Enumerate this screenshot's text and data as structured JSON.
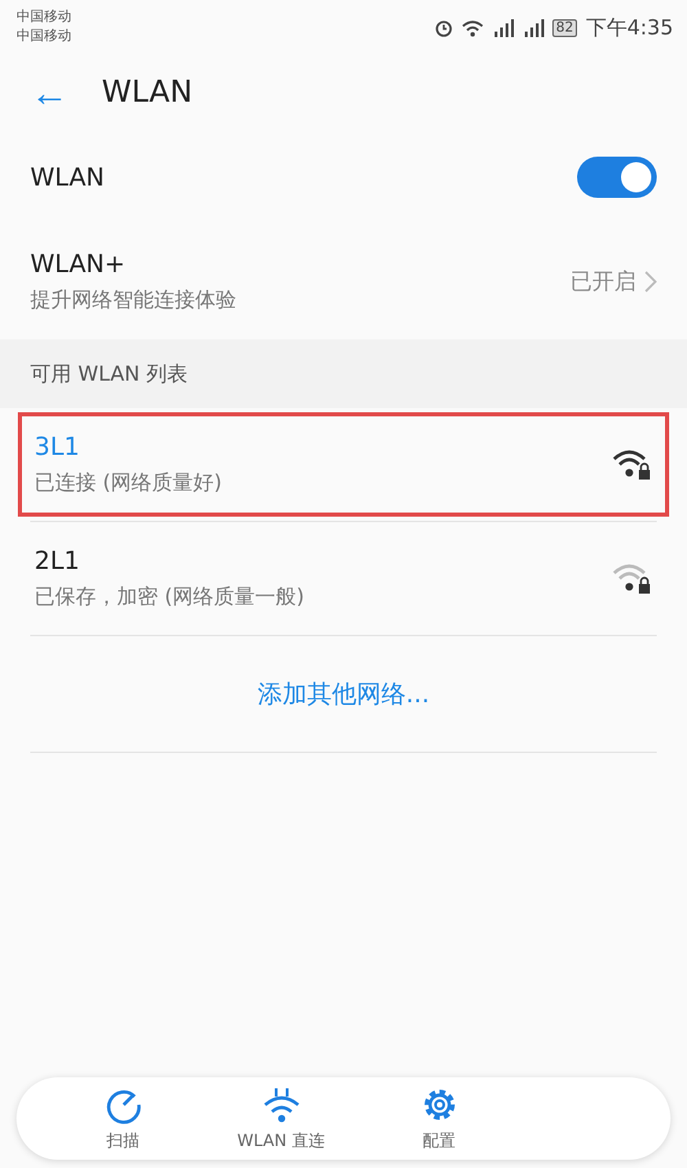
{
  "status_bar": {
    "carriers": [
      "中国移动",
      "中国移动"
    ],
    "battery": "82",
    "time": "下午4:35"
  },
  "header": {
    "back": "←",
    "title": "WLAN"
  },
  "wlan_toggle": {
    "label": "WLAN",
    "on": true
  },
  "wlan_plus": {
    "label": "WLAN+",
    "subtitle": "提升网络智能连接体验",
    "value": "已开启"
  },
  "section_title": "可用 WLAN 列表",
  "networks": [
    {
      "name": "3L1",
      "status": "已连接 (网络质量好)",
      "connected": true,
      "highlighted": true,
      "strong_signal": true
    },
    {
      "name": "2L1",
      "status": "已保存，加密 (网络质量一般)",
      "connected": false,
      "highlighted": false,
      "strong_signal": false
    }
  ],
  "add_network": "添加其他网络...",
  "bottom_bar": [
    {
      "kind": "scan",
      "label": "扫描"
    },
    {
      "kind": "direct",
      "label": "WLAN 直连"
    },
    {
      "kind": "config",
      "label": "配置"
    }
  ]
}
